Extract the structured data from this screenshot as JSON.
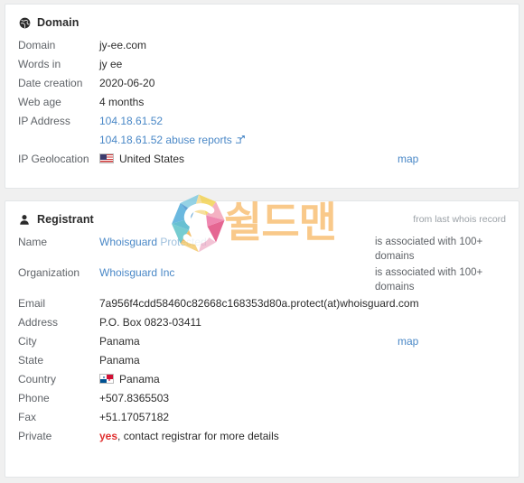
{
  "domain_section": {
    "icon": "globe-icon",
    "title": "Domain",
    "rows": [
      {
        "label": "Domain",
        "value": "jy-ee.com"
      },
      {
        "label": "Words in",
        "value": "jy ee"
      },
      {
        "label": "Date creation",
        "value": "2020-06-20"
      },
      {
        "label": "Web age",
        "value": "4 months"
      },
      {
        "label": "IP Address",
        "value": "104.18.61.52"
      },
      {
        "label": "",
        "value": "104.18.61.52 abuse reports"
      },
      {
        "label": "IP Geolocation",
        "value": "United States"
      }
    ],
    "ip_link": "104.18.61.52",
    "abuse_link": "104.18.61.52 abuse reports",
    "geo_country": "United States",
    "geo_flag": "us-flag-icon",
    "map_label": "map",
    "external_icon": "external-link-icon"
  },
  "registrant_section": {
    "icon": "person-icon",
    "title": "Registrant",
    "note": "from last whois record",
    "rows": [
      {
        "label": "Name",
        "value": "Whoisguard",
        "value2": "Protected",
        "note": "is associated with 100+ domains"
      },
      {
        "label": "Organization",
        "value": "Whoisguard Inc",
        "note": "is associated with 100+ domains"
      },
      {
        "label": "Email",
        "value": "7a956f4cdd58460c82668c168353d80a.protect(at)whoisguard.com"
      },
      {
        "label": "Address",
        "value": "P.O. Box 0823-03411"
      },
      {
        "label": "City",
        "value": "Panama",
        "map": "map"
      },
      {
        "label": "State",
        "value": "Panama"
      },
      {
        "label": "Country",
        "value": "Panama",
        "flag": "panama-flag-icon"
      },
      {
        "label": "Phone",
        "value": "+507.8365503"
      },
      {
        "label": "Fax",
        "value": "+51.17057182"
      },
      {
        "label": "Private",
        "value": "yes",
        "value2": ", contact registrar for more details"
      }
    ]
  },
  "watermark": {
    "logo": "shieldman-s-logo",
    "text": "쉴드맨"
  },
  "colors": {
    "link": "#4a88c7",
    "label": "#5f6368",
    "alert": "#e03131",
    "border": "#e3e6e8",
    "page_bg": "#f0f0f0",
    "watermark_text": "#f9c98a"
  }
}
